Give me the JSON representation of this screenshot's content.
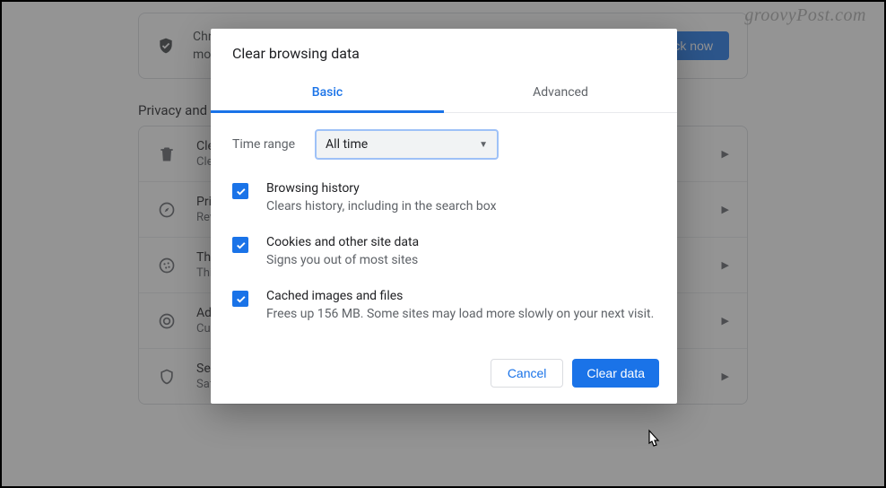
{
  "watermark": "groovyPost.com",
  "background": {
    "banner": {
      "text": "Chrome can help keep you safe from data breaches, bad extensions, and more",
      "button": "Check now"
    },
    "section_title": "Privacy and security",
    "rows": [
      {
        "icon": "trash",
        "title": "Clear browsing data",
        "sub": "Clear history, cookies, cache, and more"
      },
      {
        "icon": "compass",
        "title": "Privacy Guide",
        "sub": "Review key privacy and security controls"
      },
      {
        "icon": "cookie",
        "title": "Third-party cookies",
        "sub": "Third-party cookies are blocked"
      },
      {
        "icon": "target",
        "title": "Ad privacy",
        "sub": "Customize the info used by sites to show you ads"
      },
      {
        "icon": "shield",
        "title": "Security",
        "sub": "Safe Browsing (protection from dangerous sites) and other security settings"
      }
    ]
  },
  "dialog": {
    "title": "Clear browsing data",
    "tabs": {
      "basic": "Basic",
      "advanced": "Advanced",
      "active": "basic"
    },
    "time_range": {
      "label": "Time range",
      "value": "All time"
    },
    "options": [
      {
        "checked": true,
        "title": "Browsing history",
        "sub": "Clears history, including in the search box"
      },
      {
        "checked": true,
        "title": "Cookies and other site data",
        "sub": "Signs you out of most sites"
      },
      {
        "checked": true,
        "title": "Cached images and files",
        "sub": "Frees up 156 MB. Some sites may load more slowly on your next visit."
      }
    ],
    "buttons": {
      "cancel": "Cancel",
      "confirm": "Clear data"
    }
  }
}
